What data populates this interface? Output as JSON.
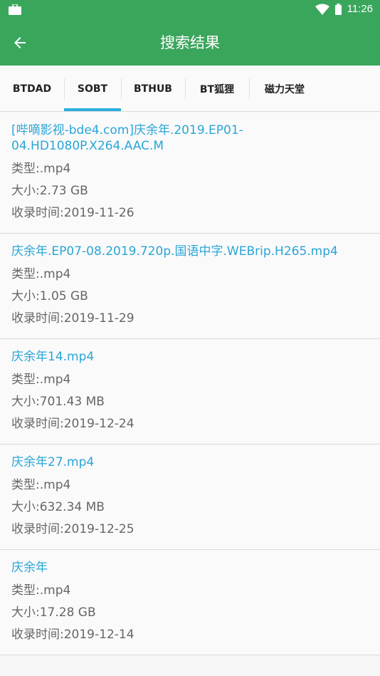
{
  "status": {
    "time": "11:26"
  },
  "header": {
    "title": "搜索结果"
  },
  "tabs": [
    {
      "label": "BTDAD"
    },
    {
      "label": "SOBT"
    },
    {
      "label": "BTHUB"
    },
    {
      "label": "BT狐狸"
    },
    {
      "label": "磁力天堂"
    }
  ],
  "results": [
    {
      "title": "[哔嘀影视-bde4.com]庆余年.2019.EP01-04.HD1080P.X264.AAC.M",
      "type": "类型:.mp4",
      "size": "大小:2.73 GB",
      "time": "收录时间:2019-11-26"
    },
    {
      "title": "庆余年.EP07-08.2019.720p.国语中字.WEBrip.H265.mp4",
      "type": "类型:.mp4",
      "size": "大小:1.05 GB",
      "time": "收录时间:2019-11-29"
    },
    {
      "title": "庆余年14.mp4",
      "type": "类型:.mp4",
      "size": "大小:701.43 MB",
      "time": "收录时间:2019-12-24"
    },
    {
      "title": "庆余年27.mp4",
      "type": "类型:.mp4",
      "size": "大小:632.34 MB",
      "time": "收录时间:2019-12-25"
    },
    {
      "title": "庆余年",
      "type": "类型:.mp4",
      "size": "大小:17.28 GB",
      "time": "收录时间:2019-12-14"
    }
  ]
}
